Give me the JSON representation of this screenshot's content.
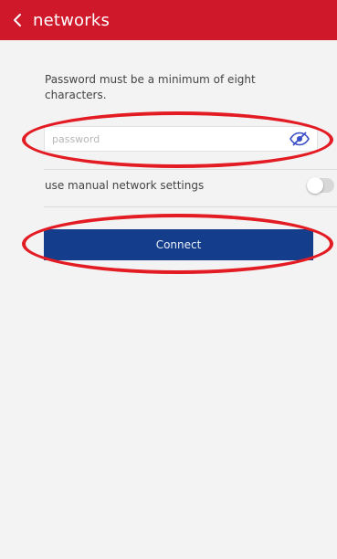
{
  "header": {
    "title": "networks",
    "color": "#d0182b"
  },
  "form": {
    "notice": "Password must be a minimum of eight characters.",
    "password": {
      "value": "",
      "placeholder": "password"
    },
    "manual_settings": {
      "label": "use manual network settings",
      "enabled": false
    },
    "connect_label": "Connect",
    "connect_color": "#143e8c"
  },
  "icons": {
    "back": "chevron-left-icon",
    "visibility": "eye-slash-icon"
  },
  "annotation_color": "#e31b23"
}
